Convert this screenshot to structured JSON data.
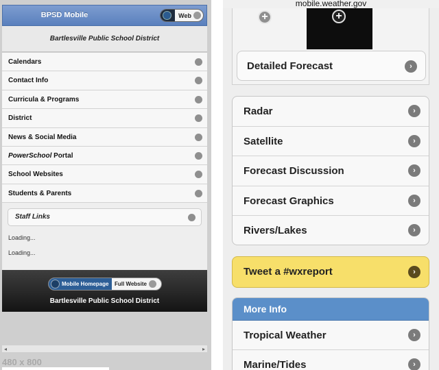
{
  "left": {
    "header": {
      "title": "BPSD Mobile",
      "toggle_label": "Web"
    },
    "banner": "Bartlesville Public School District",
    "menu": [
      {
        "label": "Calendars"
      },
      {
        "label": "Contact Info"
      },
      {
        "label": "Curricula & Programs"
      },
      {
        "label": "District"
      },
      {
        "label": "News & Social Media"
      },
      {
        "label_em": "PowerSchool",
        "label_rest": " Portal"
      },
      {
        "label": "School Websites"
      },
      {
        "label": "Students & Parents"
      }
    ],
    "staff_links": "Staff Links",
    "loading": [
      "Loading...",
      "Loading..."
    ],
    "footer": {
      "toggle_on": "Mobile Homepage",
      "toggle_off": "Full Website",
      "text": "Bartlesville Public School District"
    },
    "size_label": "480 x 800"
  },
  "right": {
    "url": "mobile.weather.gov",
    "detailed_forecast": "Detailed Forecast",
    "links": [
      "Radar",
      "Satellite",
      "Forecast Discussion",
      "Forecast Graphics",
      "Rivers/Lakes"
    ],
    "tweet": "Tweet a #wxreport",
    "more_info": {
      "header": "More Info",
      "items": [
        "Tropical Weather",
        "Marine/Tides"
      ]
    }
  },
  "colors": {
    "left_header": "#6a8ec8",
    "right_more_header": "#5b8fc9",
    "tweet_bg": "#f7df6a"
  }
}
